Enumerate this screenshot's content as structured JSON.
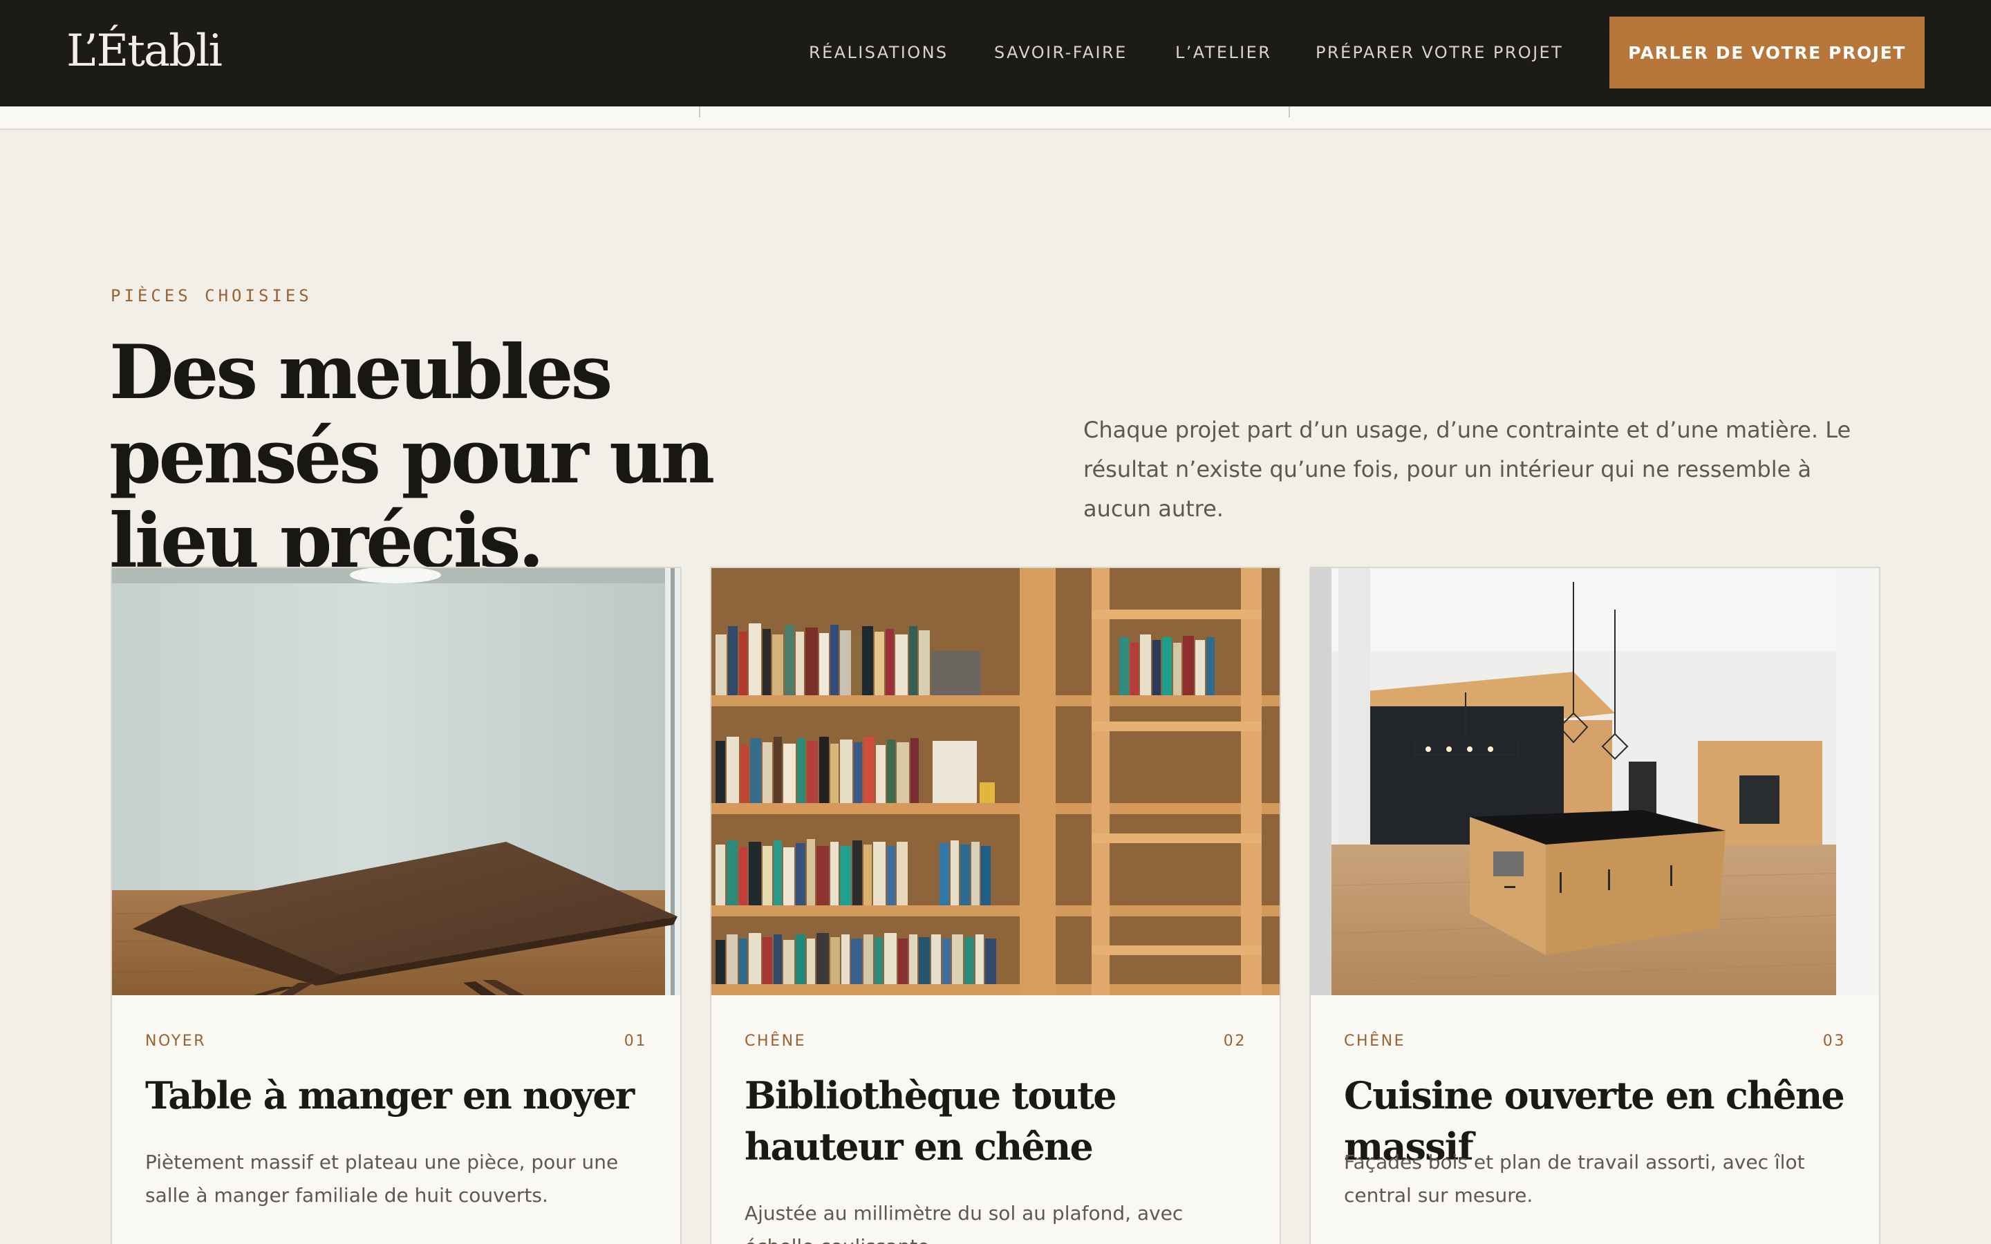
{
  "brand": {
    "logo": "L’Établi"
  },
  "nav": {
    "links": [
      "RÉALISATIONS",
      "SAVOIR-FAIRE",
      "L’ATELIER",
      "PRÉPARER VOTRE PROJET"
    ],
    "cta": "PARLER DE VOTRE PROJET"
  },
  "intro": {
    "eyebrow": "PIÈCES CHOISIES",
    "headline": "Des meubles pensés pour un lieu précis.",
    "lede": "Chaque projet part d’un usage, d’une contrainte et d’une matière. Le résultat n’existe qu’une fois, pour un intérieur qui ne ressemble à aucun autre."
  },
  "cards": [
    {
      "material": "NOYER",
      "number": "01",
      "title": "Table à manger en noyer",
      "description": "Piètement massif et plateau une pièce, pour une salle à manger familiale de huit couverts."
    },
    {
      "material": "CHÊNE",
      "number": "02",
      "title": "Bibliothèque toute hauteur en chêne",
      "description": "Ajustée au millimètre du sol au plafond, avec échelle coulissante."
    },
    {
      "material": "CHÊNE",
      "number": "03",
      "title": "Cuisine ouverte en chêne massif",
      "description": "Façades bois et plan de travail assorti, avec îlot central sur mesure."
    }
  ],
  "colors": {
    "header_bg": "#1d1b18",
    "accent": "#b7773b",
    "eyebrow": "#9a6133",
    "page_bg": "#f1efe8",
    "card_bg": "#faf8f3"
  }
}
